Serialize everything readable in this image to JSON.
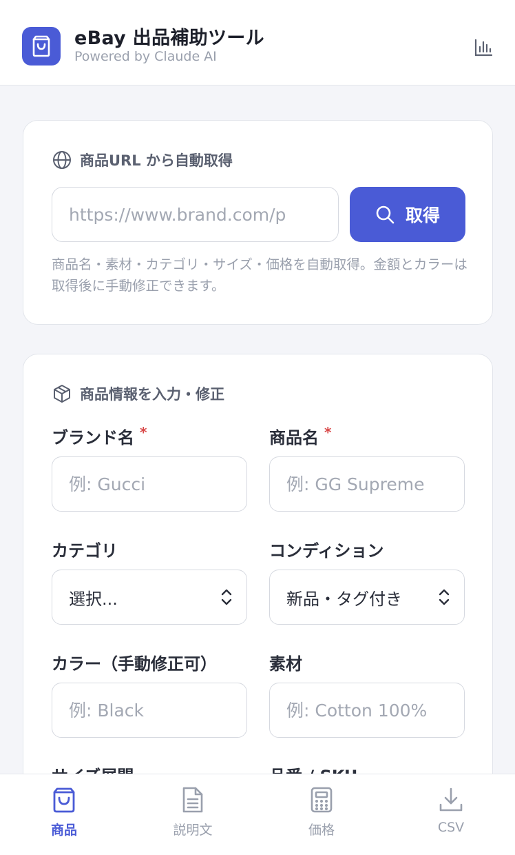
{
  "header": {
    "title": "eBay 出品補助ツール",
    "subtitle": "Powered by Claude AI",
    "app_icon": "shopping-bag-icon",
    "stats_icon": "bar-chart-icon"
  },
  "url_section": {
    "title": "商品URL から自動取得",
    "icon": "globe-icon",
    "input_placeholder": "https://www.brand.com/p",
    "fetch_label": "取得",
    "hint": "商品名・素材・カテゴリ・サイズ・価格を自動取得。金額とカラーは取得後に手動修正できます。"
  },
  "info_section": {
    "title": "商品情報を入力・修正",
    "icon": "package-icon",
    "required_mark": "*",
    "brand": {
      "label": "ブランド名",
      "placeholder": "例: Gucci"
    },
    "product": {
      "label": "商品名",
      "placeholder": "例: GG Supreme"
    },
    "category": {
      "label": "カテゴリ",
      "value": "選択..."
    },
    "condition": {
      "label": "コンディション",
      "value": "新品・タグ付き"
    },
    "color": {
      "label": "カラー（手動修正可）",
      "placeholder": "例: Black"
    },
    "material": {
      "label": "素材",
      "placeholder": "例: Cotton 100%"
    },
    "size": {
      "label": "サイズ展開"
    },
    "sku": {
      "label": "品番 / SKU"
    }
  },
  "nav": {
    "items": [
      {
        "label": "商品",
        "icon": "shopping-bag-icon",
        "active": true
      },
      {
        "label": "説明文",
        "icon": "document-icon",
        "active": false
      },
      {
        "label": "価格",
        "icon": "calculator-icon",
        "active": false
      },
      {
        "label": "CSV",
        "icon": "download-icon",
        "active": false
      }
    ]
  },
  "colors": {
    "accent": "#4a5bd6",
    "required": "#d94a4a",
    "background": "#f4f5f9"
  }
}
